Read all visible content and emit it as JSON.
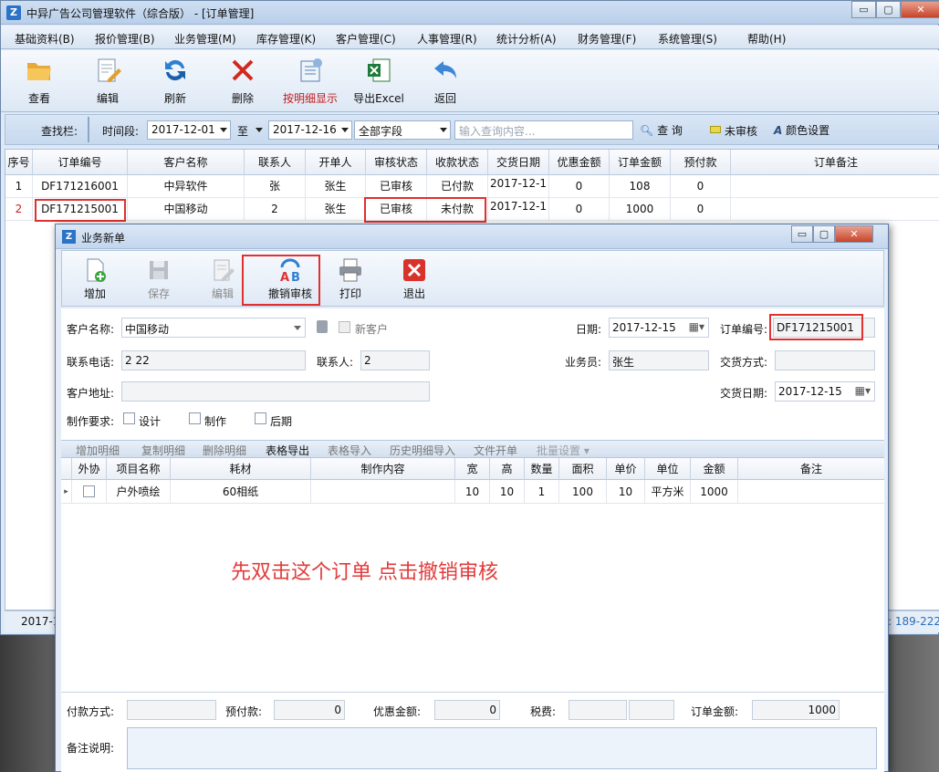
{
  "main_window": {
    "title": "中异广告公司管理软件（综合版） - [订单管理]",
    "controls": {
      "minimize": "▭",
      "restore": "▢",
      "close": "✕"
    }
  },
  "menu": [
    "基础资料(B)",
    "报价管理(B)",
    "业务管理(M)",
    "库存管理(K)",
    "客户管理(C)",
    "人事管理(R)",
    "统计分析(A)",
    "财务管理(F)",
    "系统管理(S)",
    "帮助(H)"
  ],
  "toolbar": {
    "view": "查看",
    "edit": "编辑",
    "refresh": "刷新",
    "delete": "删除",
    "detail_toggle": "按明细显示",
    "export_excel": "导出Excel",
    "back": "返回"
  },
  "search": {
    "label": "查找栏:",
    "period_label": "时间段:",
    "date_from": "2017-12-01",
    "to_label": "至",
    "date_to": "2017-12-16",
    "field": "全部字段",
    "placeholder": "输入查询内容...",
    "query_button": "查 询",
    "legend_unaudited": "未审核",
    "color_settings": "颜色设置"
  },
  "orders": {
    "columns": [
      "序号",
      "订单编号",
      "客户名称",
      "联系人",
      "开单人",
      "审核状态",
      "收款状态",
      "交货日期",
      "优惠金额",
      "订单金额",
      "预付款",
      "订单备注"
    ],
    "rows": [
      [
        "1",
        "DF171216001",
        "中异软件",
        "张",
        "张生",
        "已审核",
        "已付款",
        "2017-12-1",
        "0",
        "108",
        "0",
        ""
      ],
      [
        "2",
        "DF171215001",
        "中国移动",
        "2",
        "张生",
        "已审核",
        "未付款",
        "2017-12-1",
        "0",
        "1000",
        "0",
        ""
      ]
    ]
  },
  "status": {
    "left": "2017-1",
    "right": ": 189-222"
  },
  "dialog": {
    "title": "业务新单",
    "toolbar": {
      "add": "增加",
      "save": "保存",
      "edit": "编辑",
      "revoke_audit": "撤销审核",
      "print": "打印",
      "exit": "退出"
    },
    "form": {
      "customer_label": "客户名称:",
      "customer_value": "中国移动",
      "new_customer": "新客户",
      "date_label": "日期:",
      "date_value": "2017-12-15",
      "order_no_label": "订单编号:",
      "order_no_value": "DF171215001",
      "phone_label": "联系电话:",
      "phone_value": "2 22",
      "contact_label": "联系人:",
      "contact_value": "2",
      "salesman_label": "业务员:",
      "salesman_value": "张生",
      "delivery_method_label": "交货方式:",
      "delivery_method_value": "",
      "address_label": "客户地址:",
      "address_value": "",
      "delivery_date_label": "交货日期:",
      "delivery_date_value": "2017-12-15",
      "req_label": "制作要求:",
      "req_design": "设计",
      "req_make": "制作",
      "req_post": "后期"
    },
    "sub_toolbar": [
      "增加明细",
      "复制明细",
      "删除明细",
      "表格导出",
      "表格导入",
      "历史明细导入",
      "文件开单",
      "批量设置 ▾"
    ],
    "details": {
      "columns": [
        "外协",
        "项目名称",
        "耗材",
        "制作内容",
        "宽",
        "高",
        "数量",
        "面积",
        "单价",
        "单位",
        "金额",
        "备注"
      ],
      "rows": [
        [
          "",
          "户外喷绘",
          "60相纸",
          "",
          "10",
          "10",
          "1",
          "100",
          "10",
          "平方米",
          "1000",
          ""
        ]
      ]
    },
    "footer": {
      "payment_label": "付款方式:",
      "payment_value": "",
      "prepay_label": "预付款:",
      "prepay_value": "0",
      "discount_label": "优惠金额:",
      "discount_value": "0",
      "tax_label": "税费:",
      "tax_value": "",
      "total_label": "订单金额:",
      "total_value": "1000",
      "remark_label": "备注说明:",
      "remark_value": ""
    }
  },
  "annotation": "先双击这个订单 点击撤销审核",
  "colors": {
    "highlight": "#e03030",
    "annotation": "#e33b3b",
    "row_no_2": "#d02020"
  }
}
